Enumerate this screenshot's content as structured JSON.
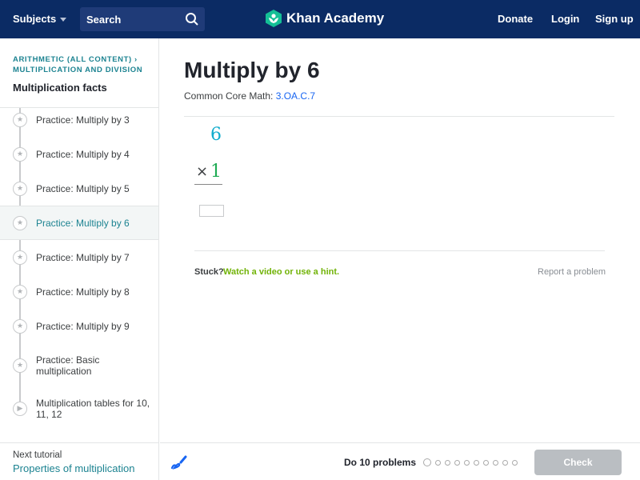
{
  "header": {
    "subjects": "Subjects",
    "search_placeholder": "Search",
    "logo": "Khan Academy",
    "donate": "Donate",
    "login": "Login",
    "signup": "Sign up"
  },
  "sidebar": {
    "breadcrumb1": "ARITHMETIC (ALL CONTENT)",
    "breadcrumb_sep": "›",
    "breadcrumb2": "MULTIPLICATION AND DIVISION",
    "title": "Multiplication facts",
    "items": [
      {
        "label": "Practice: Multiply by 3",
        "icon": "star-icon"
      },
      {
        "label": "Practice: Multiply by 4",
        "icon": "star-icon"
      },
      {
        "label": "Practice: Multiply by 5",
        "icon": "star-icon"
      },
      {
        "label": "Practice: Multiply by 6",
        "icon": "star-icon"
      },
      {
        "label": "Practice: Multiply by 7",
        "icon": "star-icon"
      },
      {
        "label": "Practice: Multiply by 8",
        "icon": "star-icon"
      },
      {
        "label": "Practice: Multiply by 9",
        "icon": "star-icon"
      },
      {
        "label": "Practice: Basic multiplication",
        "icon": "star-icon"
      },
      {
        "label": "Multiplication tables for 10, 11, 12",
        "icon": "play-icon"
      }
    ],
    "next_label": "Next tutorial",
    "next_link": "Properties of multiplication"
  },
  "main": {
    "title": "Multiply by 6",
    "standard_label": "Common Core Math:",
    "standard_link": "3.OA.C.7",
    "problem": {
      "top": "6",
      "operator": "×",
      "bottom": "1",
      "answer": ""
    },
    "stuck": "Stuck?",
    "hint": "Watch a video or use a hint.",
    "report": "Report a problem"
  },
  "footer": {
    "goal": "Do 10 problems",
    "check": "Check",
    "progress_done": 0,
    "progress_total": 10
  },
  "colors": {
    "header": "#0b2b64",
    "teal": "#1c8391",
    "blue": "#1865f2",
    "green": "#71b307"
  }
}
